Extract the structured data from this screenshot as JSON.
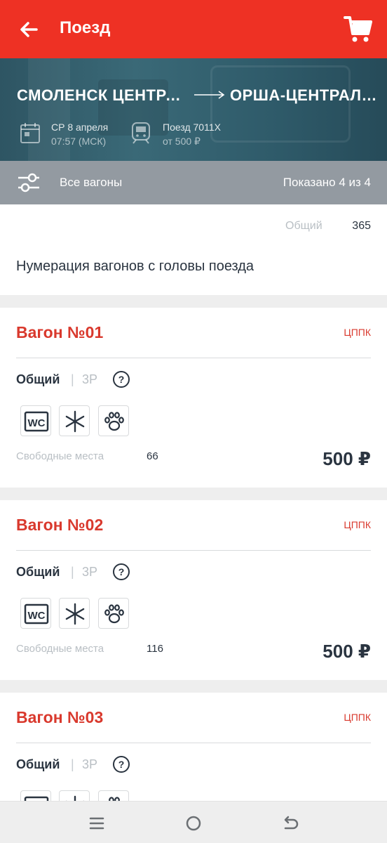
{
  "header": {
    "title": "Поезд",
    "back_icon": "arrow-left-icon",
    "cart_icon": "cart-icon"
  },
  "route": {
    "from": "СМОЛЕНСК ЦЕНТРАЛЬНЫЙ",
    "to": "ОРША-ЦЕНТРАЛЬНАЯ",
    "date": "СР 8 апреля",
    "time": "07:57 (МСК)",
    "train": "Поезд 7011Х",
    "price_from": "от 500 ₽"
  },
  "filter": {
    "label": "Все вагоны",
    "count": "Показано 4 из 4",
    "icon": "sliders-icon"
  },
  "info": {
    "type": "Общий",
    "number": "365",
    "note": "Нумерация вагонов с головы поезда"
  },
  "cars": [
    {
      "title": "Вагон №01",
      "carrier": "ЦППК",
      "class": "Общий",
      "sep": "|",
      "service": "3Р",
      "seats_label": "Свободные места",
      "seats": "66",
      "price": "500 ₽",
      "amenities": [
        "wc-icon",
        "snowflake-icon",
        "paw-icon"
      ]
    },
    {
      "title": "Вагон №02",
      "carrier": "ЦППК",
      "class": "Общий",
      "sep": "|",
      "service": "3Р",
      "seats_label": "Свободные места",
      "seats": "116",
      "price": "500 ₽",
      "amenities": [
        "wc-icon",
        "snowflake-icon",
        "paw-icon"
      ]
    },
    {
      "title": "Вагон №03",
      "carrier": "ЦППК",
      "class": "Общий",
      "sep": "|",
      "service": "3Р",
      "amenities": [
        "wc-icon",
        "snowflake-icon",
        "paw-icon"
      ]
    }
  ],
  "colors": {
    "brand": "#ee3124",
    "accent_text": "#d9392d",
    "filter_bar": "#939aa1",
    "hero": "#2e5563"
  }
}
